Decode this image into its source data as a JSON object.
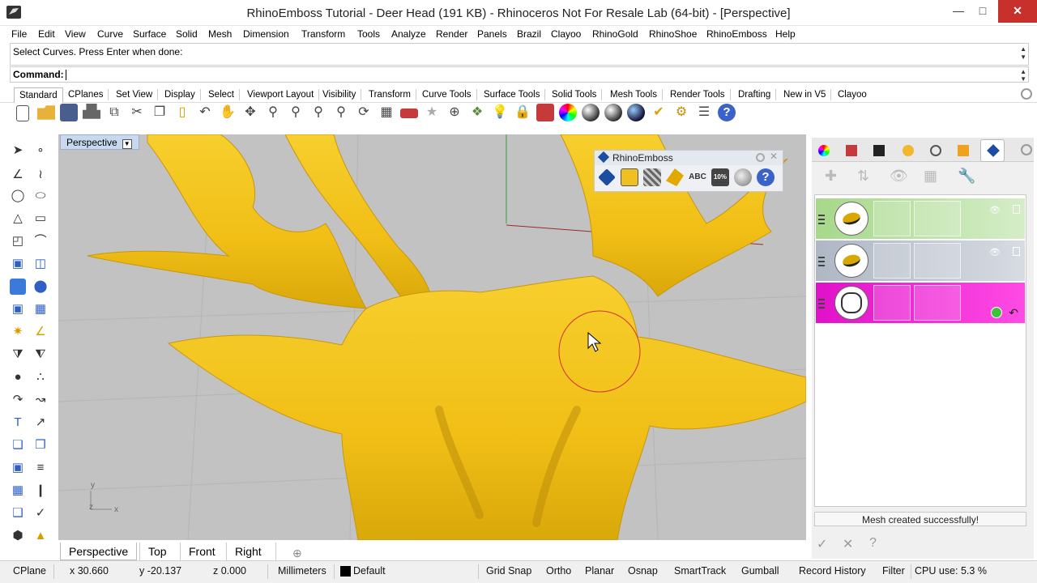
{
  "window": {
    "title": "RhinoEmboss Tutorial - Deer Head (191 KB) - Rhinoceros Not For Resale Lab (64-bit) - [Perspective]",
    "minimize_icon": "minimize-icon",
    "maximize_icon": "maximize-icon",
    "close_icon": "close-icon"
  },
  "menu": [
    "File",
    "Edit",
    "View",
    "Curve",
    "Surface",
    "Solid",
    "Mesh",
    "Dimension",
    "Transform",
    "Tools",
    "Analyze",
    "Render",
    "Panels",
    "Brazil",
    "Clayoo",
    "RhinoGold",
    "RhinoShoe",
    "RhinoEmboss",
    "Help"
  ],
  "command": {
    "history": "Select Curves. Press Enter when done:",
    "prompt": "Command:",
    "value": ""
  },
  "toolbar_tabs": [
    "Standard",
    "CPlanes",
    "Set View",
    "Display",
    "Select",
    "Viewport Layout",
    "Visibility",
    "Transform",
    "Curve Tools",
    "Surface Tools",
    "Solid Tools",
    "Mesh Tools",
    "Render Tools",
    "Drafting",
    "New in V5",
    "Clayoo"
  ],
  "toolbar_active_tab": "Standard",
  "viewport": {
    "label": "Perspective",
    "axis_x": "x",
    "axis_y": "y",
    "axis_z": "z",
    "model_color": "#f2c31c",
    "background": "#c2c2c2"
  },
  "floating_toolbar": {
    "title": "RhinoEmboss",
    "percent_icon_text": "10%",
    "abc_icon_text": "ABC"
  },
  "view_tabs": [
    "Perspective",
    "Top",
    "Front",
    "Right"
  ],
  "view_tabs_active": "Perspective",
  "add_view_icon": "plus-icon",
  "right_panel": {
    "status": "Mesh created successfully!",
    "layer_colors": [
      "#a7d88a",
      "#aeb7c4",
      "#e011c9"
    ]
  },
  "statusbar": {
    "cplane": "CPlane",
    "x": "x 30.660",
    "y": "y -20.137",
    "z": "z 0.000",
    "units": "Millimeters",
    "layer": "Default",
    "grid_snap": "Grid Snap",
    "ortho": "Ortho",
    "planar": "Planar",
    "osnap": "Osnap",
    "smarttrack": "SmartTrack",
    "gumball": "Gumball",
    "record_history": "Record History",
    "filter": "Filter",
    "cpu": "CPU use: 5.3 %"
  }
}
